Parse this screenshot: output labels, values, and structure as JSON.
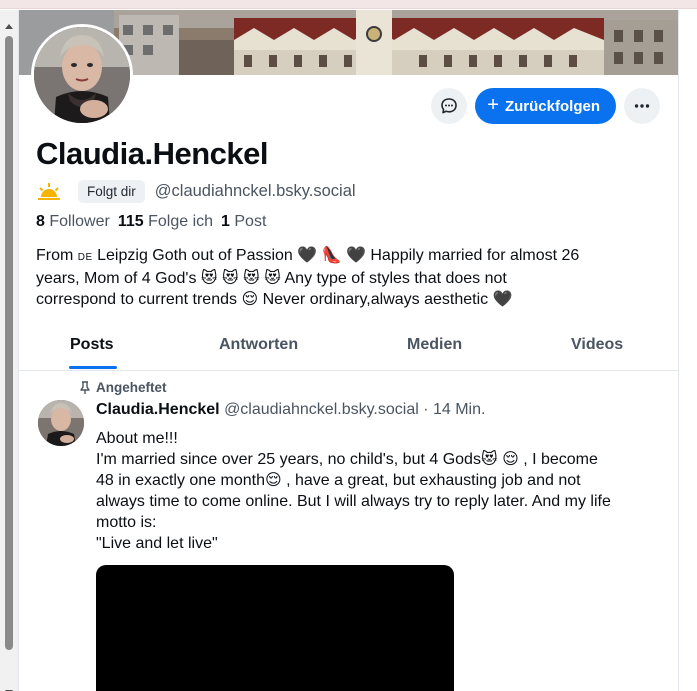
{
  "profile": {
    "display_name": "Claudia.Henckel",
    "follows_you_badge": "Folgt dir",
    "handle": "@claudiahnckel.bsky.social",
    "followers_count": "8",
    "followers_label": "Follower",
    "following_count": "115",
    "following_label": "Folge ich",
    "posts_count": "1",
    "posts_label": "Post",
    "bio_line1_a": "From ",
    "bio_flag": "DE",
    "bio_line1_b": " Leipzig Goth out of Passion 🖤 👠 🖤  Happily married for almost 26",
    "bio_line2": "years, Mom of 4 God's 😻 😻 😻 😻 Any type of styles that does not",
    "bio_line3": "correspond to current trends 😌  Never ordinary,always aesthetic 🖤"
  },
  "actions": {
    "message_icon": "chat-bubble-icon",
    "follow_back_label": "Zurückfolgen",
    "more_icon": "ellipsis-icon",
    "accent_color": "#0a72ef"
  },
  "tabs": [
    {
      "label": "Posts"
    },
    {
      "label": "Antworten"
    },
    {
      "label": "Medien"
    },
    {
      "label": "Videos"
    }
  ],
  "post": {
    "pinned_label": "Angeheftet",
    "author_name": "Claudia.Henckel",
    "author_handle": "@claudiahnckel.bsky.social",
    "separator": " · ",
    "time": "14 Min.",
    "text": "About me!!!\nI'm married since over 25 years, no child's, but 4 Gods😻 😌 , I become\n48 in exactly one month😌 , have a great, but exhausting job and not\nalways time to come online. But I will always try to reply later. And my life\nmotto is:\n\"Live and let live\""
  }
}
